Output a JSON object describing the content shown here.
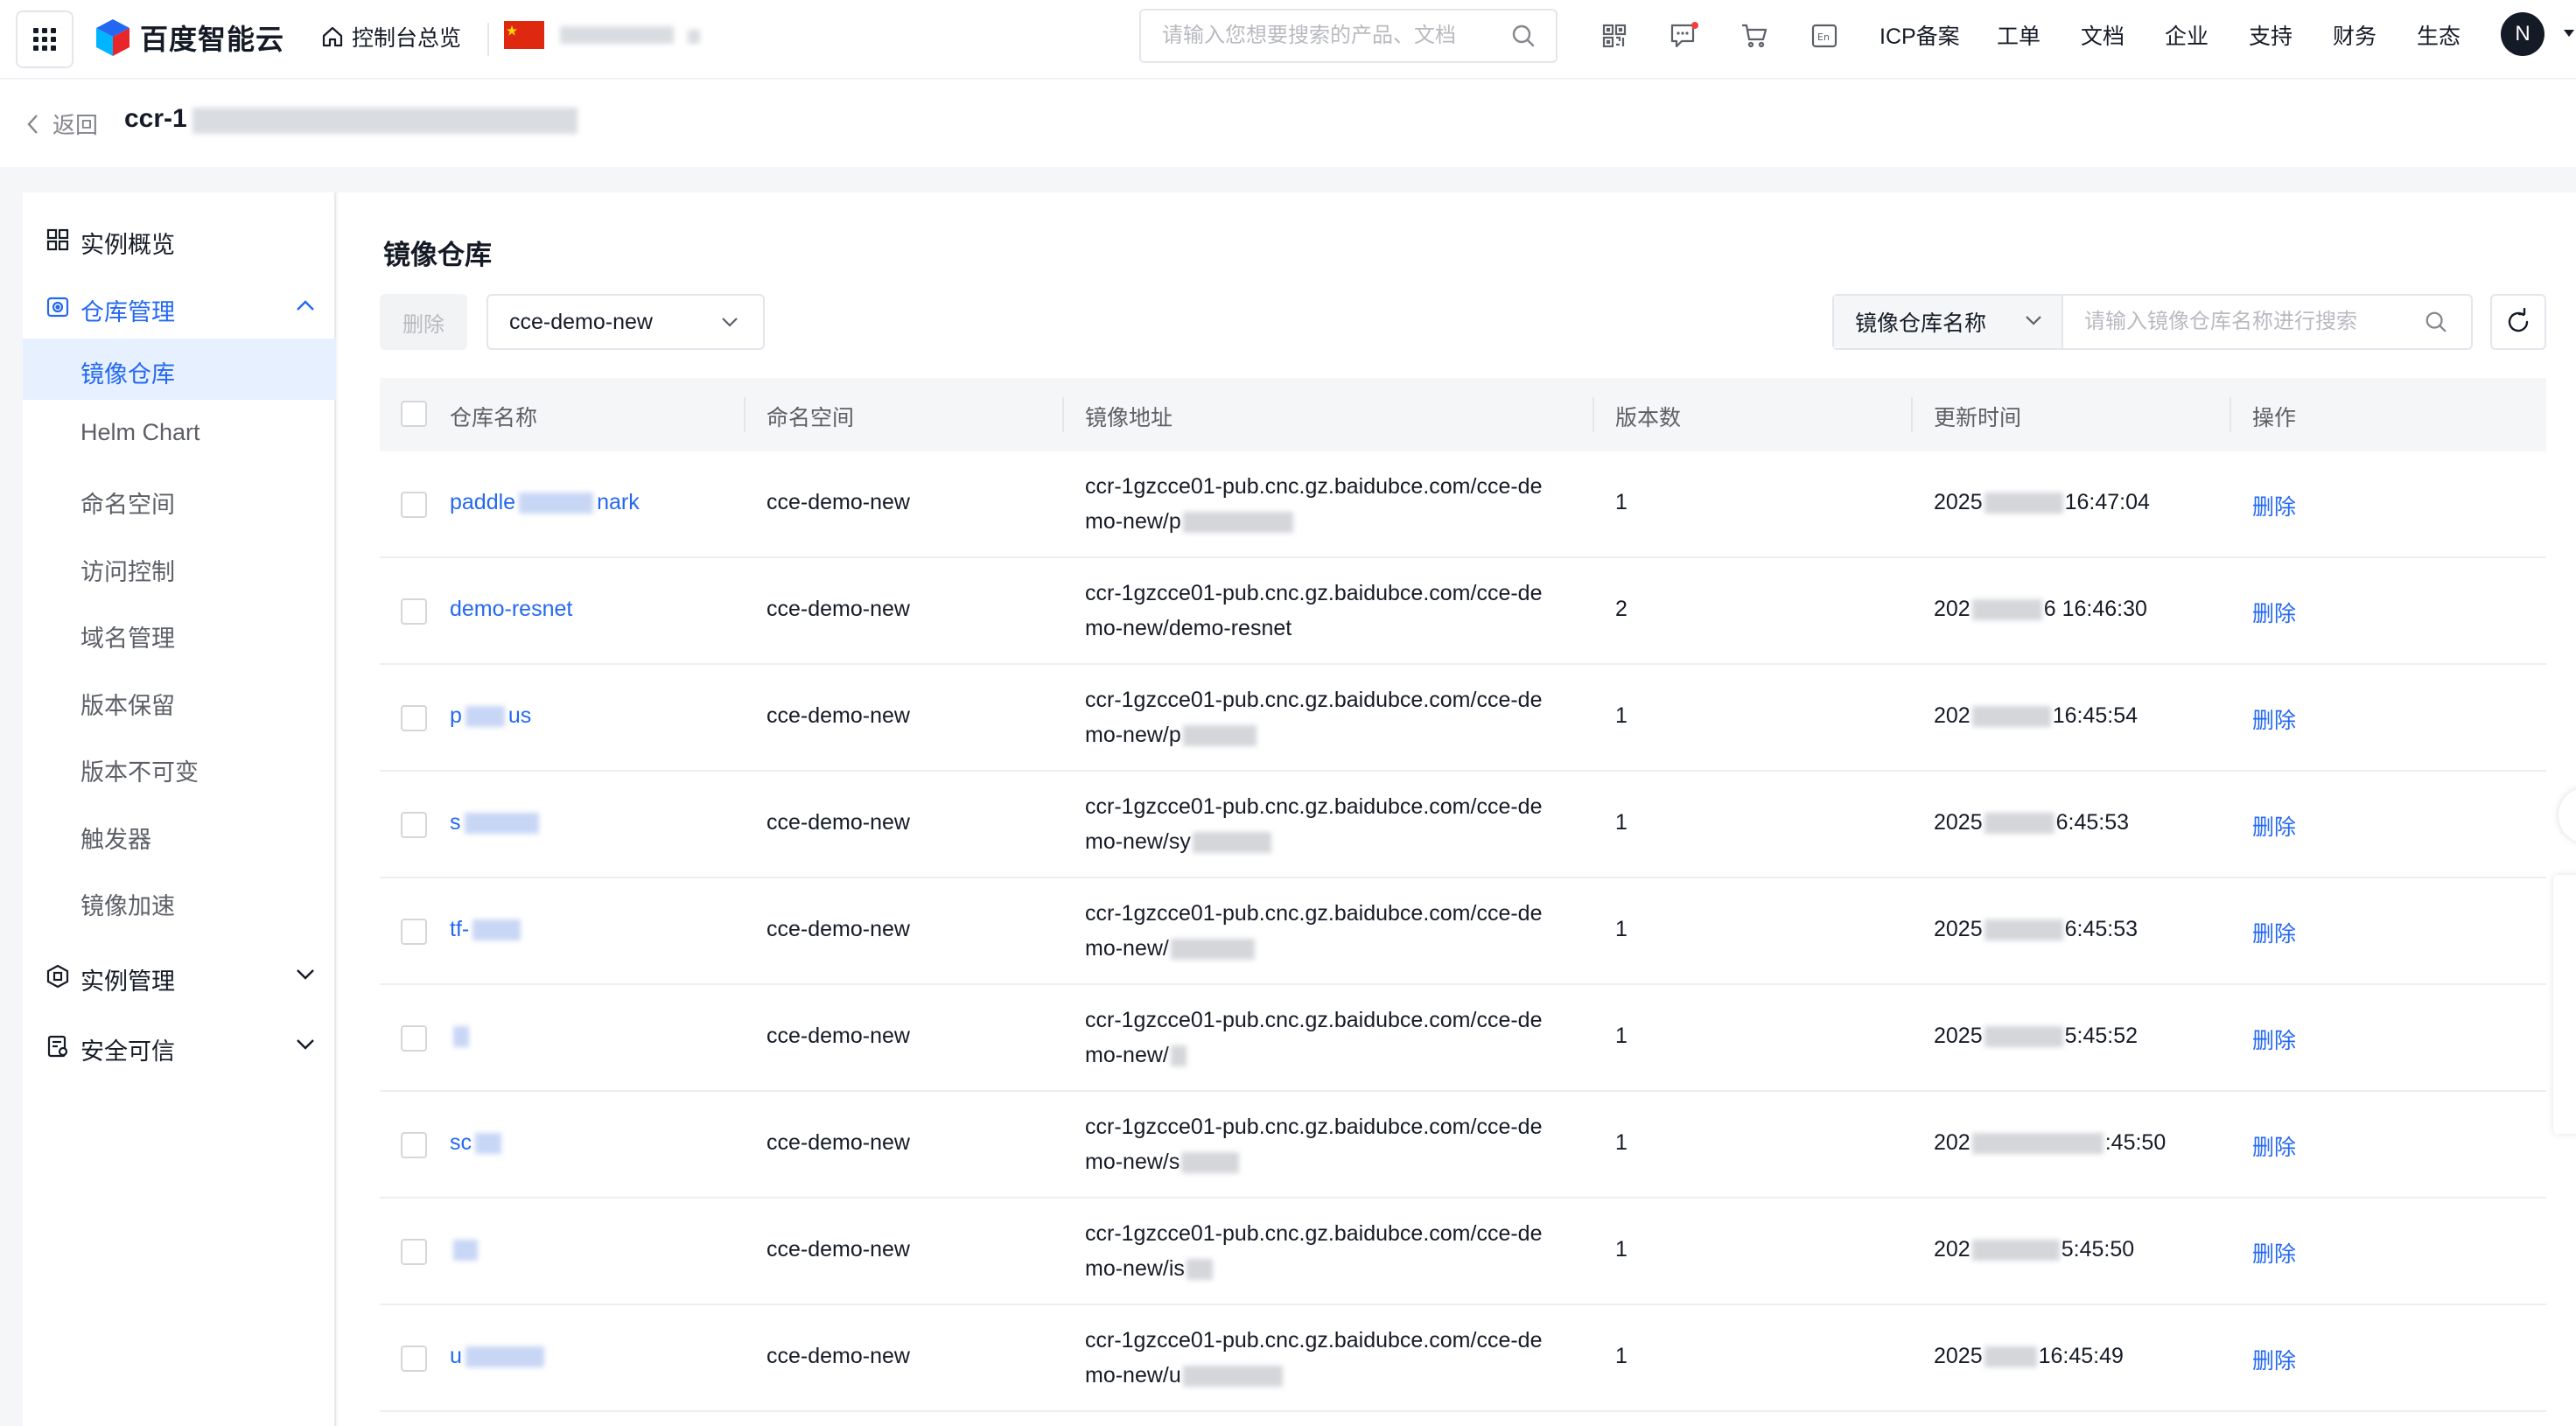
{
  "topbar": {
    "brand": "百度智能云",
    "home_label": "控制台总览",
    "search_placeholder": "请输入您想要搜索的产品、文档",
    "nav": [
      "ICP备案",
      "工单",
      "文档",
      "企业",
      "支持",
      "财务",
      "生态"
    ],
    "avatar_initial": "N",
    "icons": [
      "apps-grid-icon",
      "qrcode-icon",
      "message-icon",
      "cart-icon",
      "language-en-icon"
    ]
  },
  "breadcrumb": {
    "back_label": "返回",
    "instance_title": "ccr-1"
  },
  "sidebar": {
    "overview": "实例概览",
    "repo_group": "仓库管理",
    "repo_items": [
      "镜像仓库",
      "Helm Chart",
      "命名空间",
      "访问控制",
      "域名管理",
      "版本保留",
      "版本不可变",
      "触发器",
      "镜像加速"
    ],
    "active_item": "镜像仓库",
    "instance_group": "实例管理",
    "security_group": "安全可信"
  },
  "main": {
    "title": "镜像仓库",
    "delete_button": "删除",
    "namespace_selected": "cce-demo-new",
    "filter_key": "镜像仓库名称",
    "filter_placeholder": "请输入镜像仓库名称进行搜索",
    "columns": [
      "仓库名称",
      "命名空间",
      "镜像地址",
      "版本数",
      "更新时间",
      "操作"
    ],
    "rows": [
      {
        "name_start": "paddle",
        "name_end": "nark",
        "namespace": "cce-demo-new",
        "addr1": "ccr-1gzcce01-pub.cnc.gz.baidubce.com/cce-de",
        "addr2": "mo-new/p",
        "versions": "1",
        "time_start": "2025",
        "time_end": "16:47:04",
        "op": "删除"
      },
      {
        "name_start": "demo-resnet",
        "name_end": "",
        "namespace": "cce-demo-new",
        "addr1": "ccr-1gzcce01-pub.cnc.gz.baidubce.com/cce-de",
        "addr2": "mo-new/demo-resnet",
        "versions": "2",
        "time_start": "202",
        "time_end": "6 16:46:30",
        "op": "删除"
      },
      {
        "name_start": "p",
        "name_end": "us",
        "namespace": "cce-demo-new",
        "addr1": "ccr-1gzcce01-pub.cnc.gz.baidubce.com/cce-de",
        "addr2": "mo-new/p",
        "versions": "1",
        "time_start": "202",
        "time_end": "16:45:54",
        "op": "删除"
      },
      {
        "name_start": "s",
        "name_end": "",
        "namespace": "cce-demo-new",
        "addr1": "ccr-1gzcce01-pub.cnc.gz.baidubce.com/cce-de",
        "addr2": "mo-new/sy",
        "versions": "1",
        "time_start": "2025",
        "time_end": "6:45:53",
        "op": "删除"
      },
      {
        "name_start": "tf-",
        "name_end": "",
        "namespace": "cce-demo-new",
        "addr1": "ccr-1gzcce01-pub.cnc.gz.baidubce.com/cce-de",
        "addr2": "mo-new/",
        "versions": "1",
        "time_start": "2025",
        "time_end": "6:45:53",
        "op": "删除"
      },
      {
        "name_start": "",
        "name_end": "",
        "namespace": "cce-demo-new",
        "addr1": "ccr-1gzcce01-pub.cnc.gz.baidubce.com/cce-de",
        "addr2": "mo-new/",
        "versions": "1",
        "time_start": "2025",
        "time_end": "5:45:52",
        "op": "删除"
      },
      {
        "name_start": "sc",
        "name_end": "",
        "namespace": "cce-demo-new",
        "addr1": "ccr-1gzcce01-pub.cnc.gz.baidubce.com/cce-de",
        "addr2": "mo-new/s",
        "versions": "1",
        "time_start": "202",
        "time_end": ":45:50",
        "op": "删除"
      },
      {
        "name_start": "",
        "name_end": "",
        "namespace": "cce-demo-new",
        "addr1": "ccr-1gzcce01-pub.cnc.gz.baidubce.com/cce-de",
        "addr2": "mo-new/is",
        "versions": "1",
        "time_start": "202",
        "time_end": "5:45:50",
        "op": "删除"
      },
      {
        "name_start": "u",
        "name_end": "",
        "namespace": "cce-demo-new",
        "addr1": "ccr-1gzcce01-pub.cnc.gz.baidubce.com/cce-de",
        "addr2": "mo-new/u",
        "versions": "1",
        "time_start": "2025",
        "time_end": "16:45:49",
        "op": "删除"
      }
    ]
  },
  "colors": {
    "accent": "#2468f2",
    "active_bg": "#e6f0ff",
    "header_bg": "#f5f6f8",
    "text": "#151b26",
    "muted": "#84868c"
  }
}
